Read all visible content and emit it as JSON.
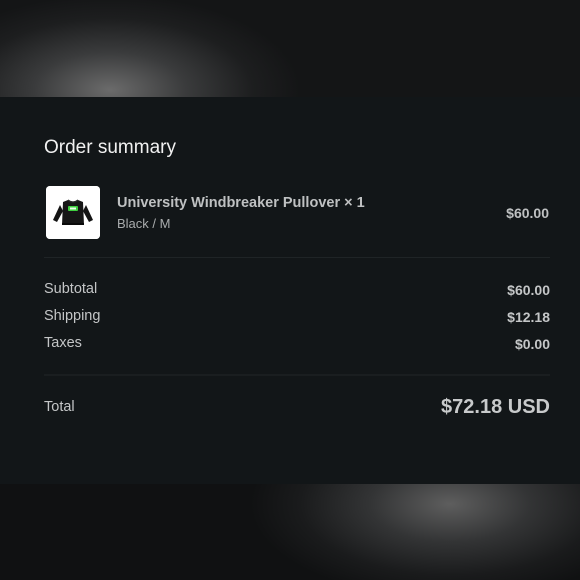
{
  "summary": {
    "title": "Order summary"
  },
  "line_item": {
    "name": "University Windbreaker Pullover × 1",
    "variant": "Black / M",
    "price": "$60.00",
    "thumbnail_icon": "black-pullover-image",
    "accent_color": "#3ecf3e"
  },
  "costs": {
    "subtotal_label": "Subtotal",
    "subtotal_value": "$60.00",
    "shipping_label": "Shipping",
    "shipping_value": "$12.18",
    "taxes_label": "Taxes",
    "taxes_value": "$0.00"
  },
  "total": {
    "label": "Total",
    "value": "$72.18 USD"
  }
}
